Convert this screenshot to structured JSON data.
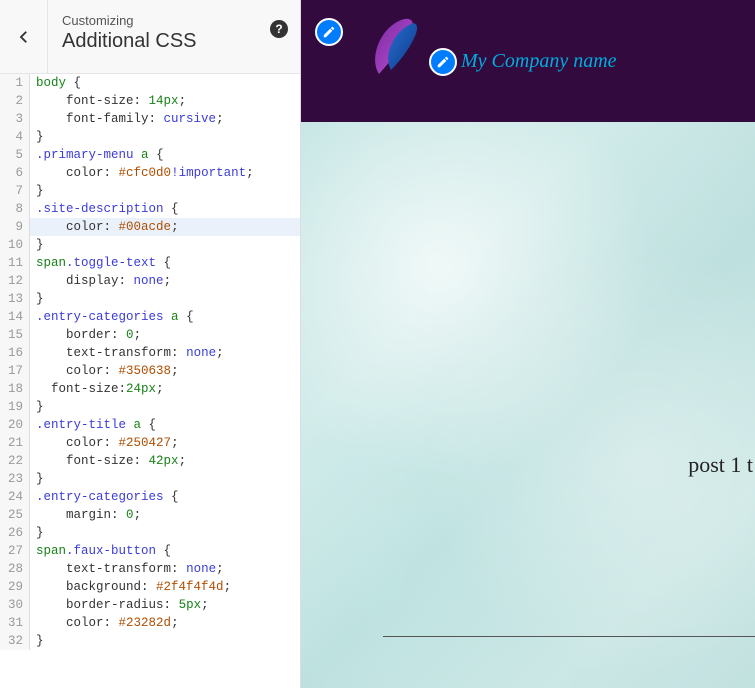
{
  "header": {
    "sub": "Customizing",
    "main": "Additional CSS",
    "help_glyph": "?"
  },
  "code": {
    "active_line_index": 8,
    "lines": [
      [
        [
          "tag",
          "body"
        ],
        [
          "punc",
          " {"
        ]
      ],
      [
        [
          "ind",
          "    "
        ],
        [
          "prop",
          "font-size"
        ],
        [
          "punc",
          ": "
        ],
        [
          "num",
          "14px"
        ],
        [
          "punc",
          ";"
        ]
      ],
      [
        [
          "ind",
          "    "
        ],
        [
          "prop",
          "font-family"
        ],
        [
          "punc",
          ": "
        ],
        [
          "kw",
          "cursive"
        ],
        [
          "punc",
          ";"
        ]
      ],
      [
        [
          "punc",
          "}"
        ]
      ],
      [
        [
          "qual",
          ".primary-menu"
        ],
        [
          "punc",
          " "
        ],
        [
          "tag",
          "a"
        ],
        [
          "punc",
          " {"
        ]
      ],
      [
        [
          "ind",
          "    "
        ],
        [
          "prop",
          "color"
        ],
        [
          "punc",
          ": "
        ],
        [
          "hex",
          "#cfc0d0"
        ],
        [
          "kw",
          "!important"
        ],
        [
          "punc",
          ";"
        ]
      ],
      [
        [
          "punc",
          "}"
        ]
      ],
      [
        [
          "qual",
          ".site-description"
        ],
        [
          "punc",
          " {"
        ]
      ],
      [
        [
          "ind",
          "    "
        ],
        [
          "prop",
          "color"
        ],
        [
          "punc",
          ": "
        ],
        [
          "hex",
          "#00acde"
        ],
        [
          "punc",
          ";"
        ]
      ],
      [
        [
          "punc",
          "}"
        ]
      ],
      [
        [
          "tag",
          "span"
        ],
        [
          "qual",
          ".toggle-text"
        ],
        [
          "punc",
          " {"
        ]
      ],
      [
        [
          "ind",
          "    "
        ],
        [
          "prop",
          "display"
        ],
        [
          "punc",
          ": "
        ],
        [
          "kw",
          "none"
        ],
        [
          "punc",
          ";"
        ]
      ],
      [
        [
          "punc",
          "}"
        ]
      ],
      [
        [
          "qual",
          ".entry-categories"
        ],
        [
          "punc",
          " "
        ],
        [
          "tag",
          "a"
        ],
        [
          "punc",
          " {"
        ]
      ],
      [
        [
          "ind",
          "    "
        ],
        [
          "prop",
          "border"
        ],
        [
          "punc",
          ": "
        ],
        [
          "num",
          "0"
        ],
        [
          "punc",
          ";"
        ]
      ],
      [
        [
          "ind",
          "    "
        ],
        [
          "prop",
          "text-transform"
        ],
        [
          "punc",
          ": "
        ],
        [
          "kw",
          "none"
        ],
        [
          "punc",
          ";"
        ]
      ],
      [
        [
          "ind",
          "    "
        ],
        [
          "prop",
          "color"
        ],
        [
          "punc",
          ": "
        ],
        [
          "hex",
          "#350638"
        ],
        [
          "punc",
          ";"
        ]
      ],
      [
        [
          "ind",
          "  "
        ],
        [
          "prop",
          "font-size"
        ],
        [
          "punc",
          ":"
        ],
        [
          "num",
          "24px"
        ],
        [
          "punc",
          ";"
        ]
      ],
      [
        [
          "punc",
          "}"
        ]
      ],
      [
        [
          "qual",
          ".entry-title"
        ],
        [
          "punc",
          " "
        ],
        [
          "tag",
          "a"
        ],
        [
          "punc",
          " {"
        ]
      ],
      [
        [
          "ind",
          "    "
        ],
        [
          "prop",
          "color"
        ],
        [
          "punc",
          ": "
        ],
        [
          "hex",
          "#250427"
        ],
        [
          "punc",
          ";"
        ]
      ],
      [
        [
          "ind",
          "    "
        ],
        [
          "prop",
          "font-size"
        ],
        [
          "punc",
          ": "
        ],
        [
          "num",
          "42px"
        ],
        [
          "punc",
          ";"
        ]
      ],
      [
        [
          "punc",
          "}"
        ]
      ],
      [
        [
          "qual",
          ".entry-categories"
        ],
        [
          "punc",
          " {"
        ]
      ],
      [
        [
          "ind",
          "    "
        ],
        [
          "prop",
          "margin"
        ],
        [
          "punc",
          ": "
        ],
        [
          "num",
          "0"
        ],
        [
          "punc",
          ";"
        ]
      ],
      [
        [
          "punc",
          "}"
        ]
      ],
      [
        [
          "tag",
          "span"
        ],
        [
          "qual",
          ".faux-button"
        ],
        [
          "punc",
          " {"
        ]
      ],
      [
        [
          "ind",
          "    "
        ],
        [
          "prop",
          "text-transform"
        ],
        [
          "punc",
          ": "
        ],
        [
          "kw",
          "none"
        ],
        [
          "punc",
          ";"
        ]
      ],
      [
        [
          "ind",
          "    "
        ],
        [
          "prop",
          "background"
        ],
        [
          "punc",
          ": "
        ],
        [
          "hex",
          "#2f4f4f4d"
        ],
        [
          "punc",
          ";"
        ]
      ],
      [
        [
          "ind",
          "    "
        ],
        [
          "prop",
          "border-radius"
        ],
        [
          "punc",
          ": "
        ],
        [
          "num",
          "5px"
        ],
        [
          "punc",
          ";"
        ]
      ],
      [
        [
          "ind",
          "    "
        ],
        [
          "prop",
          "color"
        ],
        [
          "punc",
          ": "
        ],
        [
          "hex",
          "#23282d"
        ],
        [
          "punc",
          ";"
        ]
      ],
      [
        [
          "punc",
          "}"
        ]
      ]
    ]
  },
  "preview": {
    "company_name": "My Company name",
    "post_title": "post 1 t"
  }
}
